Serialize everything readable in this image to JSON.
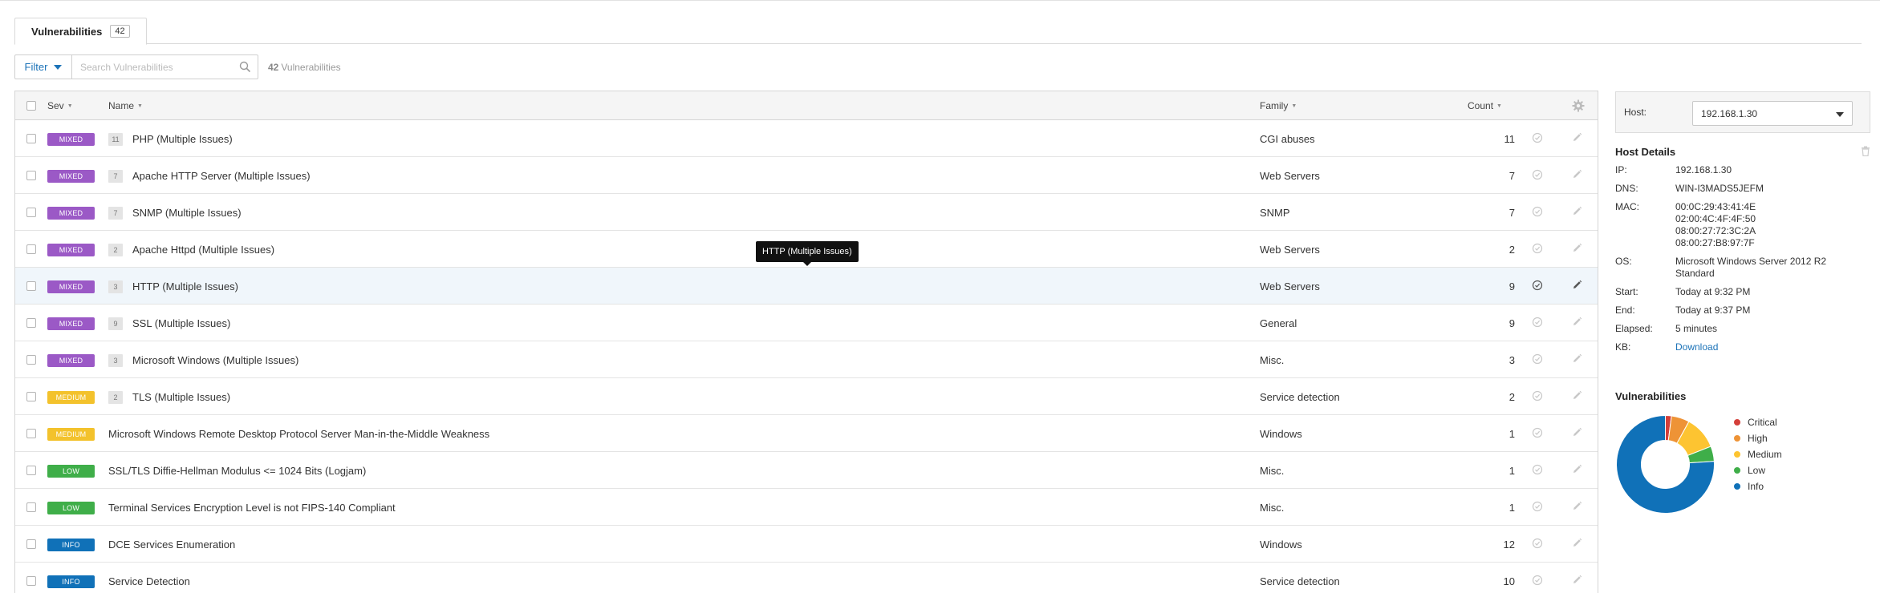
{
  "tab": {
    "label": "Vulnerabilities",
    "count": "42"
  },
  "filter": {
    "label": "Filter",
    "search_placeholder": "Search Vulnerabilities",
    "count": "42",
    "count_suffix": "Vulnerabilities"
  },
  "table": {
    "headers": {
      "sev": "Sev",
      "name": "Name",
      "family": "Family",
      "count": "Count"
    },
    "rows": [
      {
        "sev": "MIXED",
        "group": "11",
        "name": "PHP (Multiple Issues)",
        "family": "CGI abuses",
        "count": "11"
      },
      {
        "sev": "MIXED",
        "group": "7",
        "name": "Apache HTTP Server (Multiple Issues)",
        "family": "Web Servers",
        "count": "7"
      },
      {
        "sev": "MIXED",
        "group": "7",
        "name": "SNMP (Multiple Issues)",
        "family": "SNMP",
        "count": "7"
      },
      {
        "sev": "MIXED",
        "group": "2",
        "name": "Apache Httpd (Multiple Issues)",
        "family": "Web Servers",
        "count": "2"
      },
      {
        "sev": "MIXED",
        "group": "3",
        "name": "HTTP (Multiple Issues)",
        "family": "Web Servers",
        "count": "9"
      },
      {
        "sev": "MIXED",
        "group": "9",
        "name": "SSL (Multiple Issues)",
        "family": "General",
        "count": "9"
      },
      {
        "sev": "MIXED",
        "group": "3",
        "name": "Microsoft Windows (Multiple Issues)",
        "family": "Misc.",
        "count": "3"
      },
      {
        "sev": "MEDIUM",
        "group": "2",
        "name": "TLS (Multiple Issues)",
        "family": "Service detection",
        "count": "2"
      },
      {
        "sev": "MEDIUM",
        "group": "",
        "name": "Microsoft Windows Remote Desktop Protocol Server Man-in-the-Middle Weakness",
        "family": "Windows",
        "count": "1"
      },
      {
        "sev": "LOW",
        "group": "",
        "name": "SSL/TLS Diffie-Hellman Modulus <= 1024 Bits (Logjam)",
        "family": "Misc.",
        "count": "1"
      },
      {
        "sev": "LOW",
        "group": "",
        "name": "Terminal Services Encryption Level is not FIPS-140 Compliant",
        "family": "Misc.",
        "count": "1"
      },
      {
        "sev": "INFO",
        "group": "",
        "name": "DCE Services Enumeration",
        "family": "Windows",
        "count": "12"
      },
      {
        "sev": "INFO",
        "group": "",
        "name": "Service Detection",
        "family": "Service detection",
        "count": "10"
      }
    ],
    "hover_row": 4
  },
  "tooltip": {
    "text": "HTTP (Multiple Issues)"
  },
  "severity_colors": {
    "MIXED": "#9b59c6",
    "MEDIUM": "#f3c22c",
    "LOW": "#3fae49",
    "INFO": "#1071b8"
  },
  "host": {
    "label": "Host:",
    "selected": "192.168.1.30"
  },
  "host_details": {
    "title": "Host Details",
    "fields": [
      {
        "key": "IP:",
        "value": "192.168.1.30"
      },
      {
        "key": "DNS:",
        "value": "WIN-I3MADS5JEFM"
      },
      {
        "key": "MAC:",
        "value": "00:0C:29:43:41:4E\n02:00:4C:4F:4F:50\n08:00:27:72:3C:2A\n08:00:27:B8:97:7F"
      },
      {
        "key": "OS:",
        "value": "Microsoft Windows Server 2012 R2 Standard"
      },
      {
        "key": "Start:",
        "value": "Today at 9:32 PM"
      },
      {
        "key": "End:",
        "value": "Today at 9:37 PM"
      },
      {
        "key": "Elapsed:",
        "value": "5 minutes"
      },
      {
        "key": "KB:",
        "value": "Download",
        "link": true
      }
    ]
  },
  "vuln_chart": {
    "title": "Vulnerabilities",
    "legend": [
      {
        "name": "Critical",
        "color": "#d43f3a",
        "value": 2
      },
      {
        "name": "High",
        "color": "#ee9336",
        "value": 6
      },
      {
        "name": "Medium",
        "color": "#fdc431",
        "value": 11
      },
      {
        "name": "Low",
        "color": "#3fae49",
        "value": 5
      },
      {
        "name": "Info",
        "color": "#1071b8",
        "value": 76
      }
    ]
  }
}
